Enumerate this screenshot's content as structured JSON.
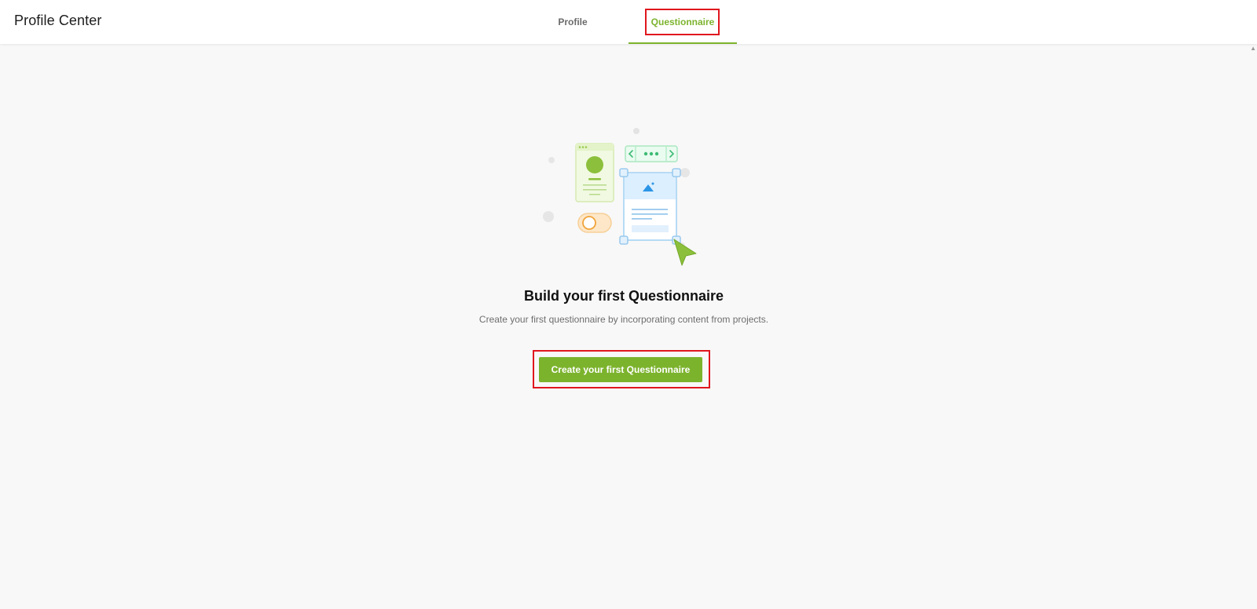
{
  "header": {
    "app_title": "Profile Center",
    "tabs": [
      {
        "label": "Profile",
        "active": false
      },
      {
        "label": "Questionnaire",
        "active": true
      }
    ]
  },
  "empty_state": {
    "illustration_icon": "questionnaire-builder-illustration",
    "headline": "Build your first Questionnaire",
    "description": "Create your first questionnaire by incorporating content from projects.",
    "cta_label": "Create your first Questionnaire"
  },
  "colors": {
    "accent": "#7cb32d",
    "highlight": "#e0161e",
    "background": "#f8f8f8"
  }
}
